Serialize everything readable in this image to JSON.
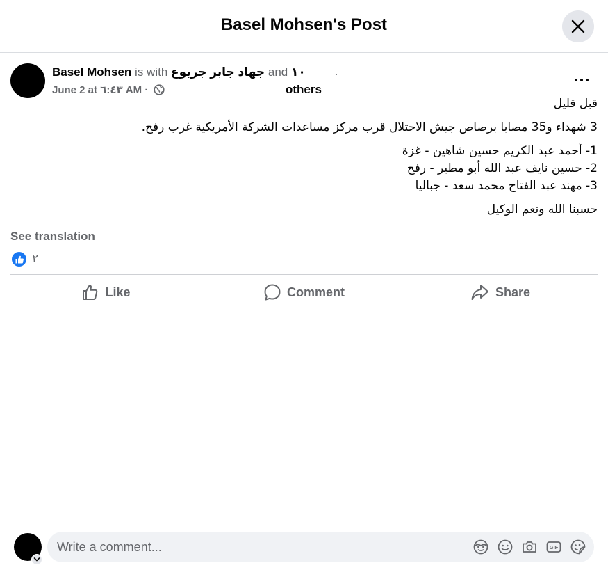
{
  "header": {
    "title": "Basel Mohsen's Post"
  },
  "post": {
    "author": "Basel Mohsen",
    "with_text": "is with",
    "tagged_person": "جهاد جابر جربوع",
    "and_text": "and",
    "others_count": "١٠",
    "dot": ".",
    "others_label": "others",
    "timestamp": "June 2 at ٦:٤٣ AM ·",
    "paragraphs": {
      "p1": "قبل قليل",
      "p2": "3 شهداء و35 مصابا برصاص جيش الاحتلال قرب مركز مساعدات الشركة الأمريكية غرب رفح.",
      "list": [
        "1- أحمد عبد الكريم حسين شاهين - غزة",
        "2- حسين نايف عبد الله أبو مطير - رفح",
        "3- مهند عبد الفتاح محمد سعد - جباليا"
      ],
      "p4": "حسبنا الله ونعم الوكيل"
    },
    "see_translation": "See translation",
    "reaction_count": "٢"
  },
  "actions": {
    "like": "Like",
    "comment": "Comment",
    "share": "Share"
  },
  "comment_box": {
    "placeholder": "Write a comment..."
  },
  "icons": {
    "close": "close-icon",
    "more": "more-icon",
    "globe": "globe-icon",
    "like": "thumbs-up-icon",
    "comment": "comment-bubble-icon",
    "share": "share-arrow-icon",
    "avatar_sticker": "avatar-sticker-icon",
    "emoji": "emoji-icon",
    "camera": "camera-icon",
    "gif": "gif-icon",
    "sticker": "sticker-icon"
  },
  "colors": {
    "accent": "#1877f2",
    "muted": "#65676b",
    "text": "#050505",
    "surface": "#f0f2f5"
  }
}
